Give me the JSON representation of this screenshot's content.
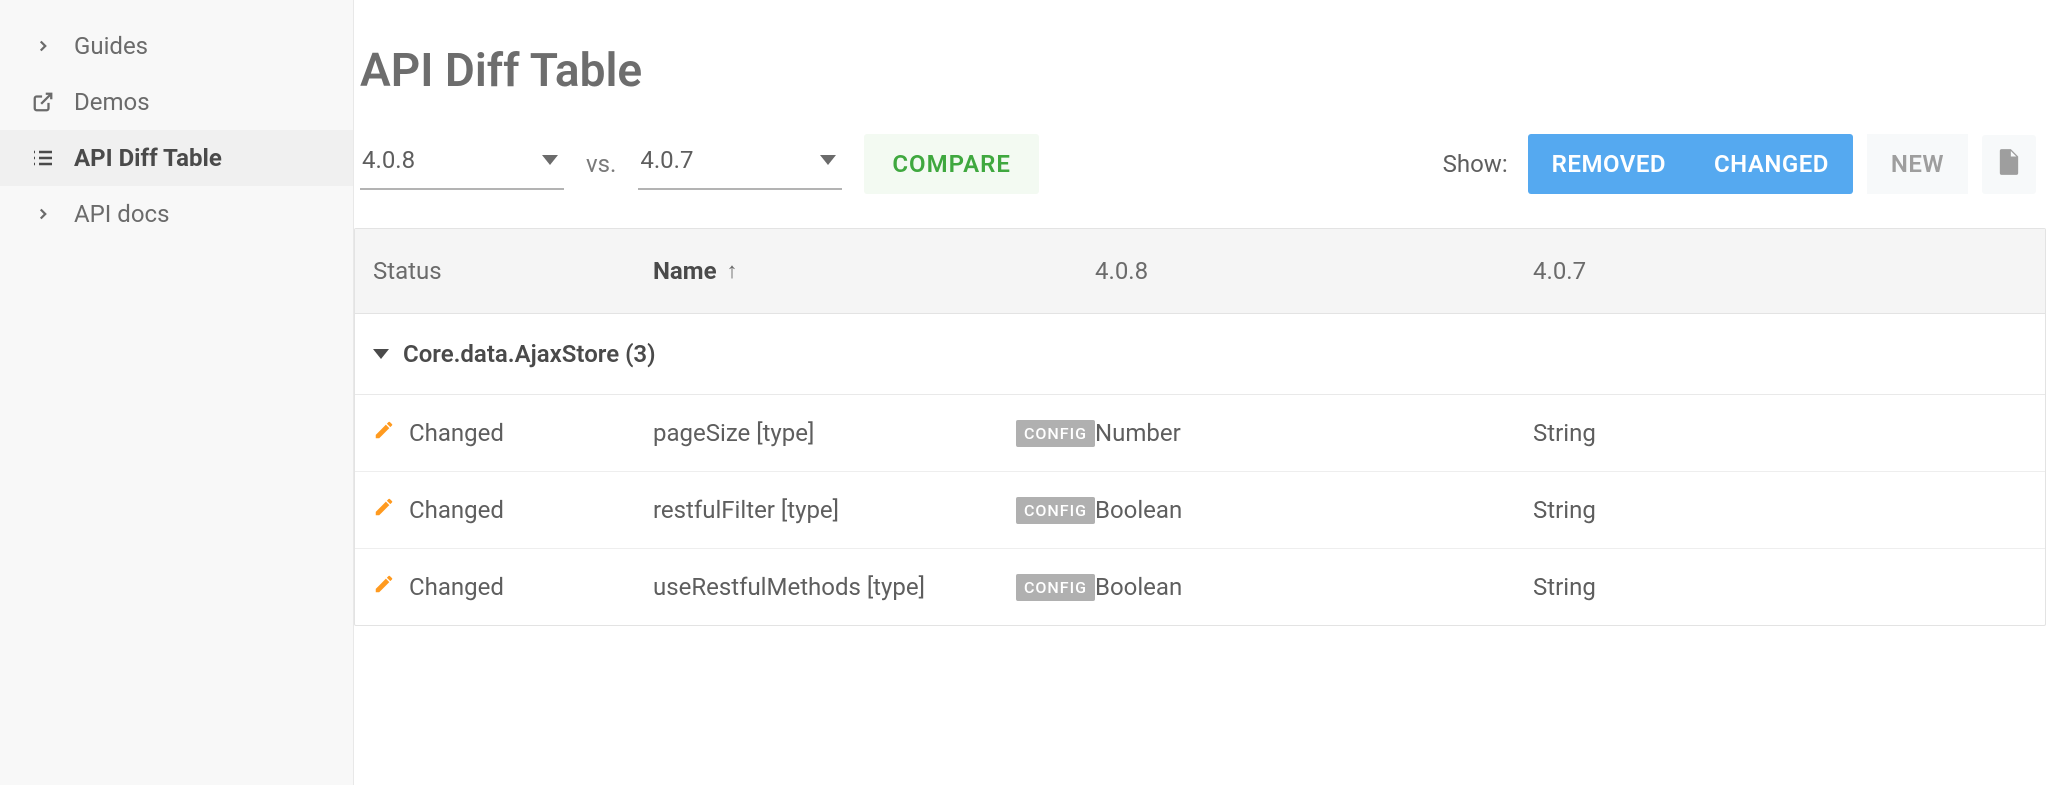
{
  "sidebar": {
    "items": [
      {
        "label": "Guides",
        "icon": "chevron-right",
        "active": false
      },
      {
        "label": "Demos",
        "icon": "external-link",
        "active": false
      },
      {
        "label": "API Diff Table",
        "icon": "list",
        "active": true
      },
      {
        "label": "API docs",
        "icon": "chevron-right",
        "active": false
      }
    ]
  },
  "page": {
    "title": "API Diff Table"
  },
  "controls": {
    "version_from": "4.0.8",
    "vs_label": "vs.",
    "version_to": "4.0.7",
    "compare_label": "COMPARE",
    "show_label": "Show:",
    "filters": {
      "removed": "REMOVED",
      "changed": "CHANGED",
      "new": "NEW"
    }
  },
  "table": {
    "columns": {
      "status": "Status",
      "name": "Name",
      "v1": "4.0.8",
      "v2": "4.0.7"
    },
    "group": {
      "title": "Core.data.AjaxStore (3)"
    },
    "rows": [
      {
        "status": "Changed",
        "name": "pageSize [type]",
        "badge": "CONFIG",
        "v1": "Number",
        "v2": "String"
      },
      {
        "status": "Changed",
        "name": "restfulFilter [type]",
        "badge": "CONFIG",
        "v1": "Boolean",
        "v2": "String"
      },
      {
        "status": "Changed",
        "name": "useRestfulMethods [type]",
        "badge": "CONFIG",
        "v1": "Boolean",
        "v2": "String"
      }
    ]
  }
}
